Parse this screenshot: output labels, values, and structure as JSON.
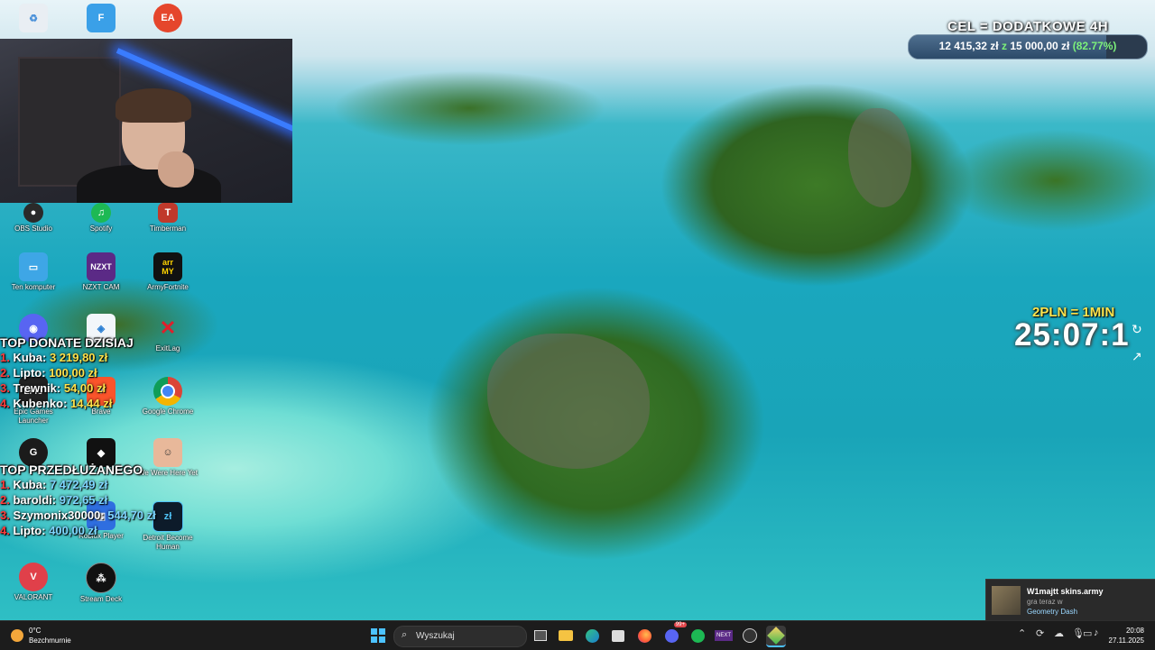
{
  "desktop_icons": [
    {
      "label": "",
      "icon": "recycle-bin-icon"
    },
    {
      "label": "",
      "icon": "fortnite-icon"
    },
    {
      "label": "",
      "icon": "ea-icon"
    },
    {
      "label": "OBS Studio",
      "icon": "obs-icon"
    },
    {
      "label": "Spotify",
      "icon": "spotify-icon"
    },
    {
      "label": "Timberman",
      "icon": "timberman-icon"
    },
    {
      "label": "Ten komputer",
      "icon": "computer-icon"
    },
    {
      "label": "NZXT CAM",
      "icon": "nzxt-icon"
    },
    {
      "label": "ArmyFortnite",
      "icon": "armyfortnite-icon"
    },
    {
      "label": "",
      "icon": "discord-icon"
    },
    {
      "label": "",
      "icon": "app-icon"
    },
    {
      "label": "ExitLag",
      "icon": "exitlag-icon"
    },
    {
      "label": "Epic Games Launcher",
      "icon": "epic-games-icon"
    },
    {
      "label": "Brave",
      "icon": "brave-icon"
    },
    {
      "label": "Google Chrome",
      "icon": "chrome-icon"
    },
    {
      "label": "",
      "icon": "logitech-icon"
    },
    {
      "label": "",
      "icon": "roblox-icon"
    },
    {
      "label": "We Were Here Yet",
      "icon": "game-icon"
    },
    {
      "label": "Roblox Player",
      "icon": "roblox-player-icon"
    },
    {
      "label": "Detroit Become Human",
      "icon": "detroit-icon"
    },
    {
      "label": "VALORANT",
      "icon": "valorant-icon"
    },
    {
      "label": "Stream Deck",
      "icon": "stream-deck-icon"
    }
  ],
  "goal": {
    "title": "CEL = DODATKOWE 4H",
    "current": "12 415,32 zł",
    "of": "z",
    "target": "15 000,00 zł",
    "percent_label": "(82.77%)",
    "fraction": 0.8277
  },
  "subathon": {
    "rate": "2PLN = 1MIN",
    "timer": "25:07:1"
  },
  "top_donate": {
    "title": "TOP DONATE DZISIAJ",
    "rows": [
      {
        "rank": "1.",
        "name": "Kuba:",
        "value": "3 219,80 zł"
      },
      {
        "rank": "2.",
        "name": "Lipto:",
        "value": "100,00 zł"
      },
      {
        "rank": "3.",
        "name": "Trewnik:",
        "value": "54,00 zł"
      },
      {
        "rank": "4.",
        "name": "Kubenko:",
        "value": "14,44 zł"
      }
    ]
  },
  "top_extend": {
    "title": "TOP PRZEDŁUŻANEGO",
    "rows": [
      {
        "rank": "1.",
        "name": "Kuba:",
        "value": "7 472,49 zł"
      },
      {
        "rank": "2.",
        "name": "baroldi:",
        "value": "972,65 zł"
      },
      {
        "rank": "3.",
        "name": "Szymonix30000:",
        "value": "544,70 zł"
      },
      {
        "rank": "4.",
        "name": "Lipto:",
        "value": "400,00 zł"
      }
    ]
  },
  "notification": {
    "user": "W1majtt skins.army",
    "status": "gra teraz w",
    "game": "Geometry Dash"
  },
  "taskbar": {
    "weather_temp": "0°C",
    "weather_desc": "Bezchmurnie",
    "search_placeholder": "Wyszukaj",
    "notification_badge": "99+",
    "time": "20:08",
    "date": "27.11.2025"
  },
  "colors": {
    "goal_accent": "#7cf07a",
    "rate_yellow": "#ffe44d",
    "rank_red": "#ff3b3b",
    "taskbar_bg": "#1c1c1c"
  }
}
